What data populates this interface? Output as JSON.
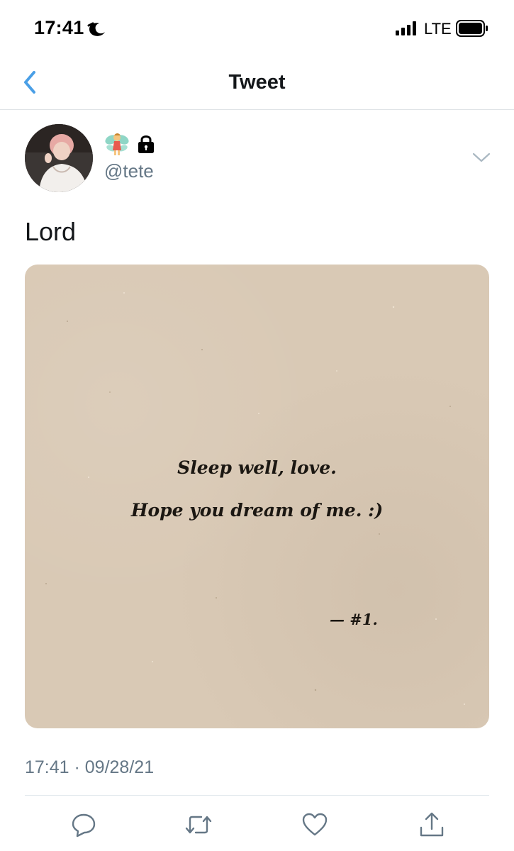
{
  "status_bar": {
    "time": "17:41",
    "network": "LTE",
    "icons": [
      "moon-icon",
      "signal-bars-icon",
      "battery-icon"
    ]
  },
  "nav": {
    "title": "Tweet",
    "back_icon": "chevron-left-icon",
    "accent_color": "#4a9fe6"
  },
  "tweet": {
    "handle": "@tete",
    "name_icons": [
      "fairy-emoji-icon",
      "lock-icon"
    ],
    "text": "Lord",
    "image": {
      "line1": "Sleep well, love.",
      "line2": "Hope you dream of me. :)",
      "signature": "— #1."
    },
    "timestamp": "17:41 · 09/28/21"
  },
  "actions": [
    {
      "name": "reply",
      "icon": "reply-bubble-icon"
    },
    {
      "name": "retweet",
      "icon": "retweet-icon"
    },
    {
      "name": "like",
      "icon": "heart-icon"
    },
    {
      "name": "share",
      "icon": "share-icon"
    }
  ],
  "colors": {
    "text": "#14171a",
    "secondary_text": "#657786",
    "divider": "#e1e8ed",
    "media_background": "#d9c9b5"
  }
}
